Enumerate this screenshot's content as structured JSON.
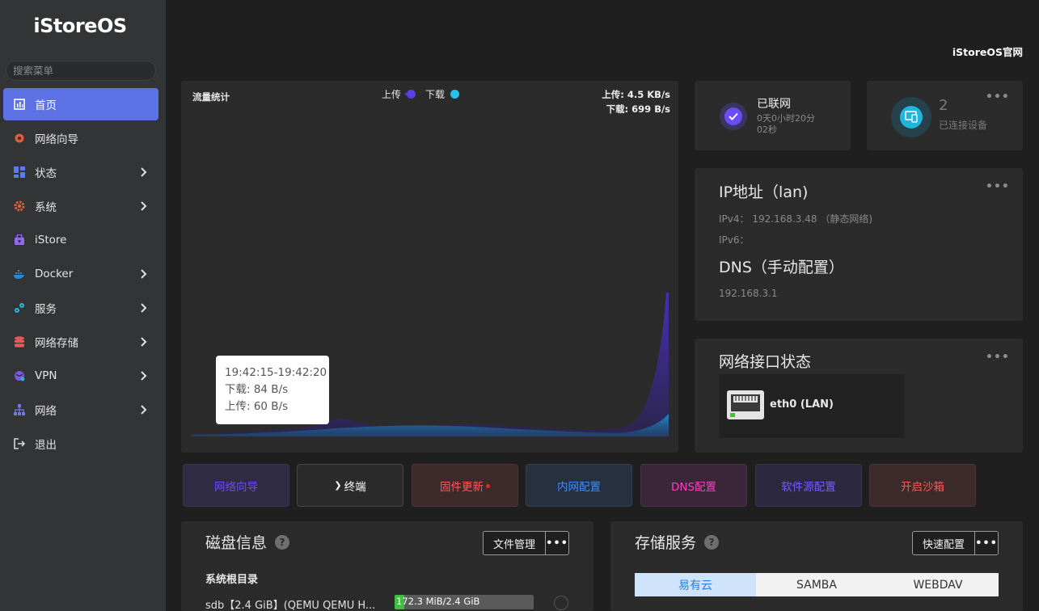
{
  "sidebar": {
    "logo": "iStoreOS",
    "search_placeholder": "搜索菜单",
    "items": [
      {
        "label": "首页",
        "icon": "dashboard-icon",
        "active": true
      },
      {
        "label": "网络向导",
        "icon": "wizard-icon"
      },
      {
        "label": "状态",
        "icon": "grid-icon"
      },
      {
        "label": "系统",
        "icon": "gear-icon"
      },
      {
        "label": "iStore",
        "icon": "store-icon"
      },
      {
        "label": "Docker",
        "icon": "docker-icon"
      },
      {
        "label": "服务",
        "icon": "services-icon"
      },
      {
        "label": "网络存储",
        "icon": "database-icon"
      },
      {
        "label": "VPN",
        "icon": "vpn-icon"
      },
      {
        "label": "网络",
        "icon": "network-icon"
      },
      {
        "label": "退出",
        "icon": "logout-icon"
      }
    ]
  },
  "header": {
    "link": "iStoreOS官网"
  },
  "traffic": {
    "title": "流量统计",
    "legend_upload": "上传",
    "legend_download": "下载",
    "upload_rate": "上传: 4.5 KB/s",
    "download_rate": "下载: 699 B/s",
    "tooltip_time": "19:42:15-19:42:20",
    "tooltip_download": "下载: 84 B/s",
    "tooltip_upload": "上传: 60 B/s",
    "colors": {
      "upload": "#5b3fe0",
      "download": "#22c3f0"
    }
  },
  "network_status": {
    "title": "已联网",
    "uptime": "0天0小时20分02秒"
  },
  "devices": {
    "count": "2",
    "label": "已连接设备"
  },
  "ip": {
    "title": "IP地址（lan)",
    "ipv4_label": "IPv4：",
    "ipv4_value": "192.168.3.48 （静态网络)",
    "ipv6_label": "IPv6：",
    "dns_title": "DNS（手动配置）",
    "dns_value": "192.168.3.1"
  },
  "interfaces": {
    "title": "网络接口状态",
    "items": [
      {
        "name": "eth0 (LAN)"
      }
    ]
  },
  "quick": [
    {
      "label": "网络向导",
      "color": "#6f4bff",
      "bg": "#2f2b45"
    },
    {
      "label": "终端",
      "prefix": "❯",
      "color": "#ffffff",
      "bg": "#2b2b2b"
    },
    {
      "label": "固件更新",
      "color": "#ff5c5c",
      "bg": "#3f2a2b"
    },
    {
      "label": "内网配置",
      "color": "#3d8dff",
      "bg": "#26303f"
    },
    {
      "label": "DNS配置",
      "color": "#ff3fbf",
      "bg": "#3a2638"
    },
    {
      "label": "软件源配置",
      "color": "#7a5cff",
      "bg": "#2b2840"
    },
    {
      "label": "开启沙箱",
      "color": "#ff5a5a",
      "bg": "#3c2a2a"
    }
  ],
  "disk": {
    "title": "磁盘信息",
    "manage_button": "文件管理",
    "section": "系统根目录",
    "row_name": "sdb【2.4 GiB】(QEMU QEMU H...",
    "usage_text": "172.3 MiB/2.4 GiB",
    "usage_fraction": 0.07
  },
  "storage": {
    "title": "存储服务",
    "config_button": "快速配置",
    "tabs": [
      "易有云",
      "SAMBA",
      "WEBDAV"
    ]
  }
}
